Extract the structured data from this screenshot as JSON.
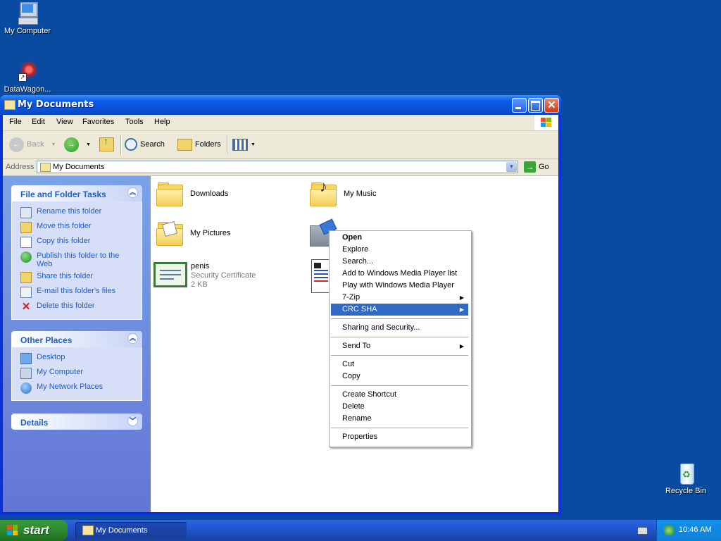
{
  "desktop": {
    "icons": [
      {
        "label": "My Computer",
        "icon": "my-computer-icon"
      },
      {
        "label": "DataWagon...",
        "icon": "datawagon-shortcut-icon"
      },
      {
        "label": "Recycle Bin",
        "icon": "recycle-bin-icon"
      }
    ]
  },
  "window": {
    "title": "My Documents",
    "menu": [
      "File",
      "Edit",
      "View",
      "Favorites",
      "Tools",
      "Help"
    ],
    "toolbar": {
      "back": "Back",
      "search": "Search",
      "folders": "Folders"
    },
    "address": {
      "label": "Address",
      "value": "My Documents",
      "go": "Go"
    }
  },
  "tasks": {
    "file_folder": {
      "title": "File and Folder Tasks",
      "items": [
        {
          "label": "Rename this folder",
          "icon": "rename-icon"
        },
        {
          "label": "Move this folder",
          "icon": "move-icon"
        },
        {
          "label": "Copy this folder",
          "icon": "copy-icon"
        },
        {
          "label": "Publish this folder to the Web",
          "icon": "publish-web-icon"
        },
        {
          "label": "Share this folder",
          "icon": "share-icon"
        },
        {
          "label": "E-mail this folder's files",
          "icon": "email-icon"
        },
        {
          "label": "Delete this folder",
          "icon": "delete-icon"
        }
      ]
    },
    "other_places": {
      "title": "Other Places",
      "items": [
        {
          "label": "Desktop",
          "icon": "desktop-icon"
        },
        {
          "label": "My Computer",
          "icon": "my-computer-icon"
        },
        {
          "label": "My Network Places",
          "icon": "network-places-icon"
        }
      ]
    },
    "details": {
      "title": "Details"
    }
  },
  "files": [
    {
      "name": "Downloads",
      "icon": "folder-icon"
    },
    {
      "name": "My Music",
      "icon": "music-folder-icon"
    },
    {
      "name": "My Pictures",
      "icon": "pictures-folder-icon"
    },
    {
      "name": "",
      "icon": "video-folder-icon"
    },
    {
      "name": "penis",
      "type": "Security Certificate",
      "size": "2 KB",
      "icon": "certificate-icon"
    },
    {
      "name": "",
      "icon": "document-icon"
    }
  ],
  "context_menu": {
    "items": [
      {
        "label": "Open",
        "bold": true
      },
      {
        "label": "Explore"
      },
      {
        "label": "Search..."
      },
      {
        "label": "Add to Windows Media Player list"
      },
      {
        "label": "Play with Windows Media Player"
      },
      {
        "label": "7-Zip",
        "submenu": true
      },
      {
        "label": "CRC SHA",
        "submenu": true,
        "highlighted": true
      },
      {
        "label": "Sharing and Security..."
      },
      {
        "label": "Send To",
        "submenu": true
      },
      {
        "label": "Cut"
      },
      {
        "label": "Copy"
      },
      {
        "label": "Create Shortcut"
      },
      {
        "label": "Delete"
      },
      {
        "label": "Rename"
      },
      {
        "label": "Properties"
      }
    ]
  },
  "taskbar": {
    "start": "start",
    "task": "My Documents",
    "clock": "10:46 AM"
  },
  "colors": {
    "desktop": "#0a4ba2",
    "highlight": "#316ac5",
    "task_link": "#215dc6"
  }
}
